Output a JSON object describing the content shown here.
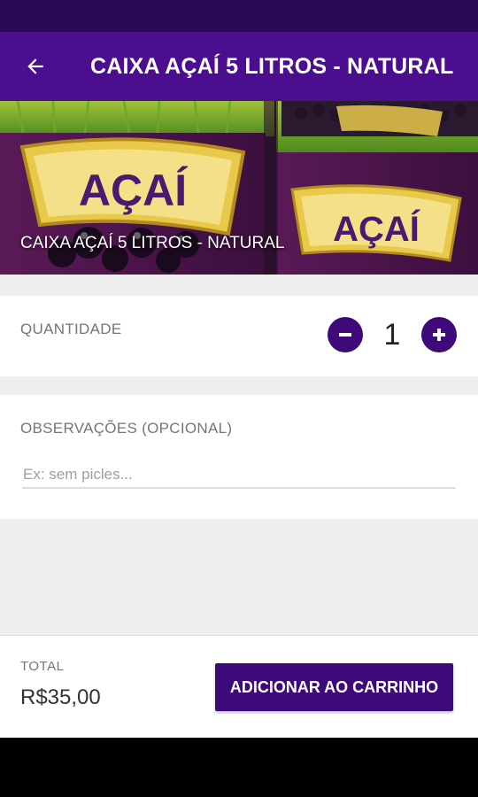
{
  "app_bar": {
    "title": "CAIXA AÇAÍ 5 LITROS - NATURAL"
  },
  "hero": {
    "caption": "CAIXA AÇAÍ 5 LITROS - NATURAL",
    "box_text": "AÇAÍ"
  },
  "quantity": {
    "label": "QUANTIDADE",
    "value": "1"
  },
  "observations": {
    "label": "OBSERVAÇÕES (OPCIONAL)",
    "placeholder": "Ex: sem picles...",
    "value": ""
  },
  "footer": {
    "total_label": "TOTAL",
    "total_value": "R$35,00",
    "add_button_label": "ADICIONAR AO CARRINHO"
  },
  "colors": {
    "primary": "#4a0e8f",
    "primary_dark": "#3e0a7a",
    "status_bar": "#2a0a55"
  }
}
